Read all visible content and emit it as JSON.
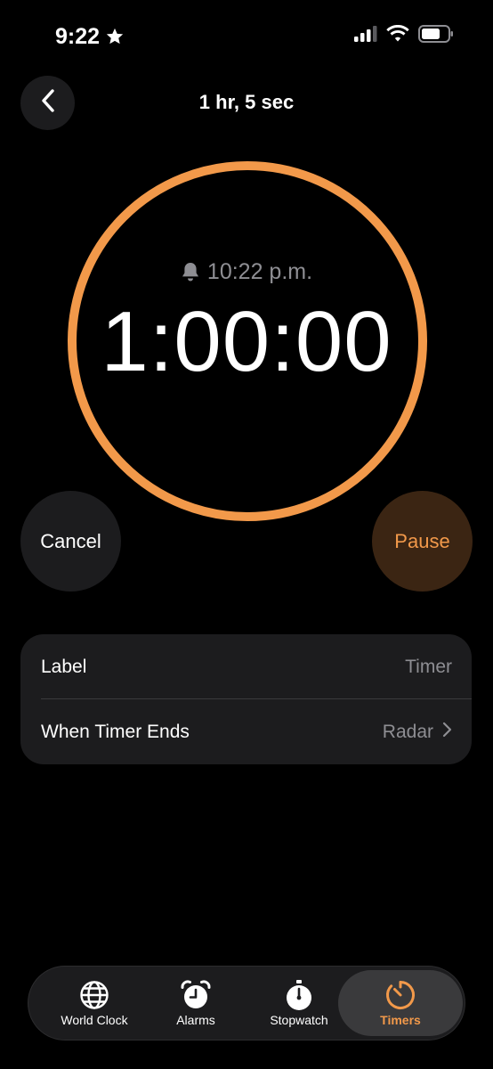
{
  "status_bar": {
    "time": "9:22"
  },
  "header": {
    "title": "1 hr, 5 sec"
  },
  "timer": {
    "end_time": "10:22 p.m.",
    "remaining": "1:00:00"
  },
  "buttons": {
    "cancel": "Cancel",
    "pause": "Pause"
  },
  "settings": {
    "label_title": "Label",
    "label_placeholder": "Timer",
    "ends_title": "When Timer Ends",
    "ends_value": "Radar"
  },
  "tabs": [
    {
      "label": "World Clock",
      "icon": "globe-icon"
    },
    {
      "label": "Alarms",
      "icon": "alarm-clock-icon"
    },
    {
      "label": "Stopwatch",
      "icon": "stopwatch-icon"
    },
    {
      "label": "Timers",
      "icon": "timer-icon",
      "selected": true
    }
  ],
  "colors": {
    "accent": "#f2994a",
    "pause_bg": "#3b2513",
    "card_bg": "#1c1c1e",
    "secondary_text": "#8e8e93"
  }
}
